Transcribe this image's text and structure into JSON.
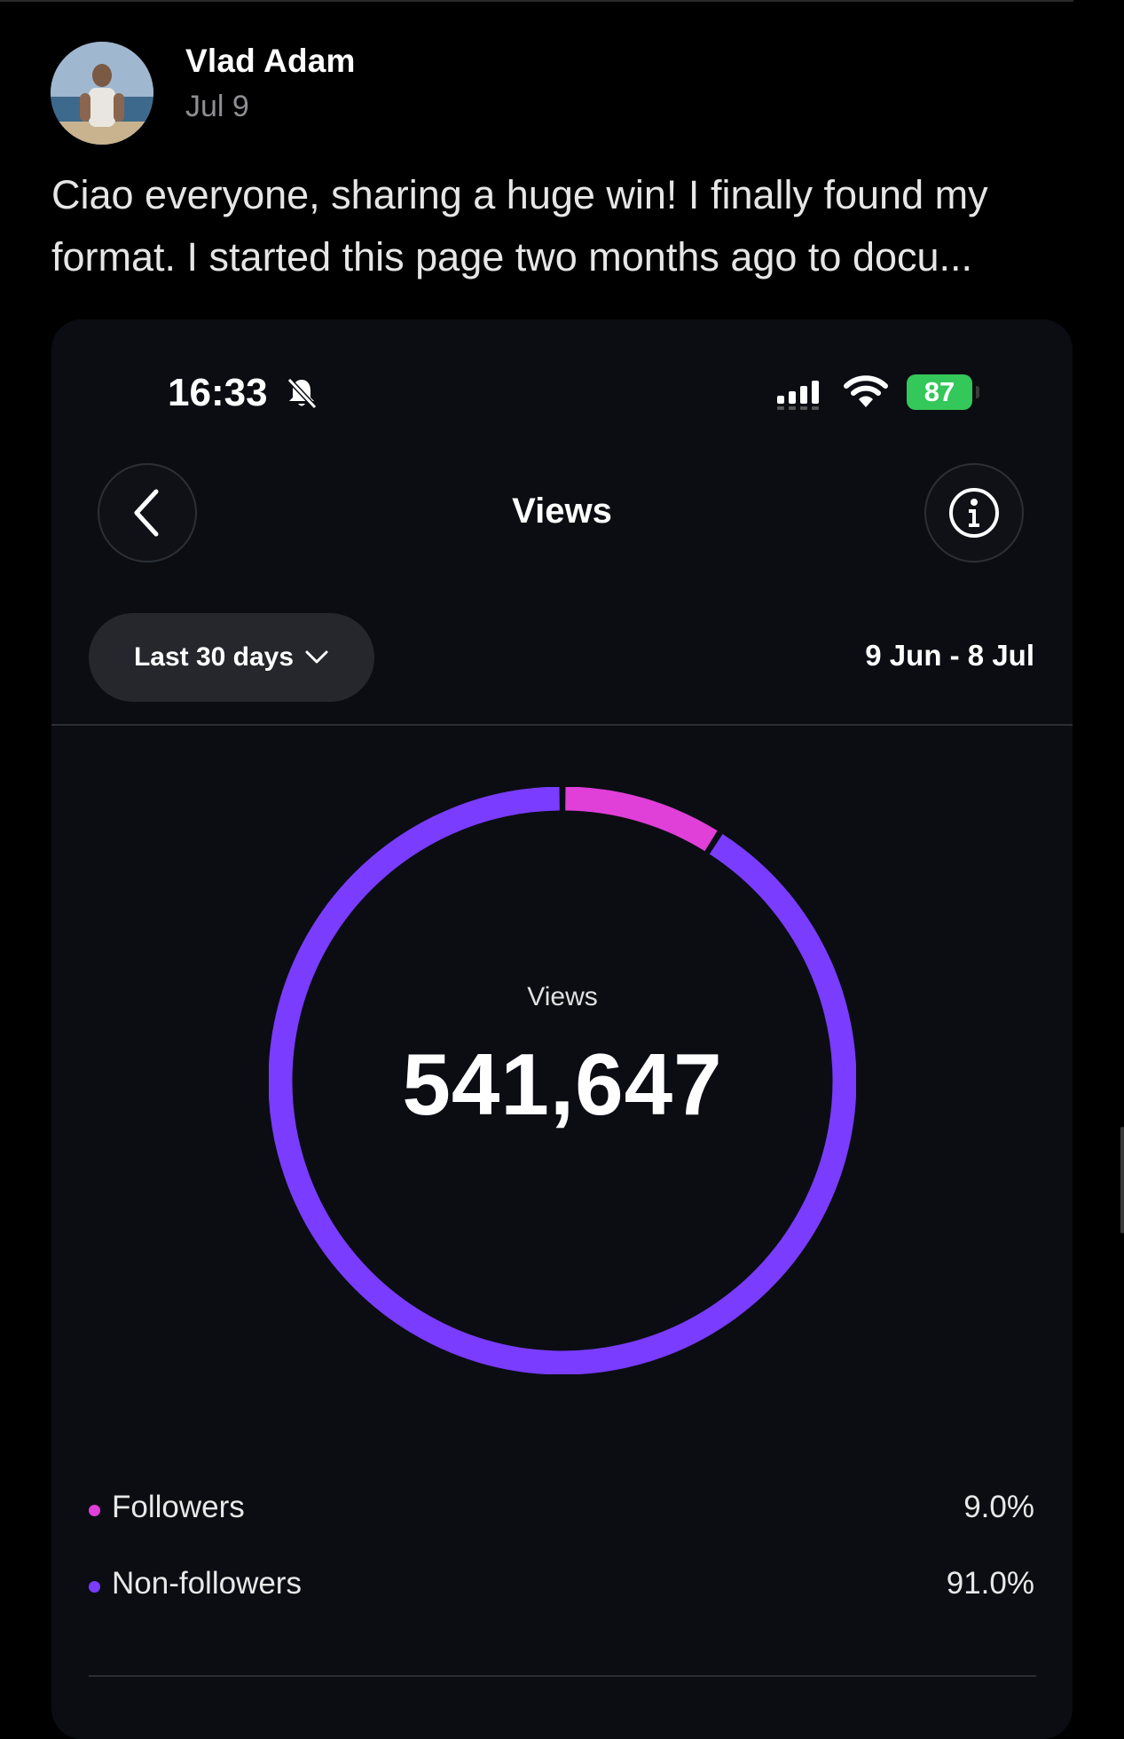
{
  "post": {
    "author": "Vlad Adam",
    "date": "Jul 9",
    "text": "Ciao everyone, sharing a huge win! I finally found my format. I started this page two months ago to docu..."
  },
  "screenshot": {
    "status_bar": {
      "time": "16:33",
      "battery": "87",
      "icons": [
        "bell-slash-icon",
        "signal-icon",
        "wifi-icon",
        "battery-charging-icon"
      ]
    },
    "header": {
      "title": "Views"
    },
    "filter": {
      "range_label": "Last 30 days",
      "date_range": "9 Jun - 8 Jul"
    },
    "summary": {
      "label": "Views",
      "value": "541,647"
    },
    "legend": [
      {
        "label": "Followers",
        "value": "9.0%",
        "color": "#e03fd8"
      },
      {
        "label": "Non-followers",
        "value": "91.0%",
        "color": "#7a3cff"
      }
    ]
  },
  "colors": {
    "accent_followers": "#e03fd8",
    "accent_nonfollowers": "#7a3cff",
    "card_bg": "#0b0d13"
  }
}
